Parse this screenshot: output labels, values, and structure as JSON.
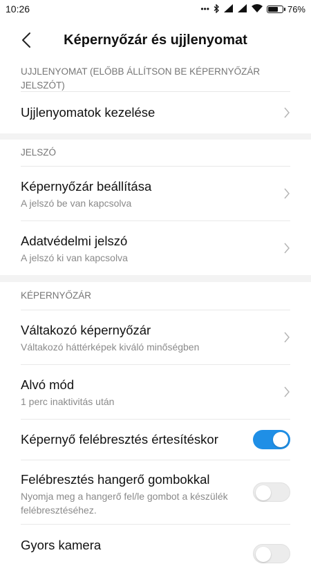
{
  "status_bar": {
    "time": "10:26",
    "battery_percent": "76%",
    "battery_level": 0.76,
    "icons": [
      "dots-icon",
      "bluetooth-icon",
      "signal-icon",
      "signal-icon",
      "wifi-icon",
      "battery-icon"
    ]
  },
  "header": {
    "title": "Képernyőzár és ujjlenyomat",
    "back_icon": "back-arrow-icon"
  },
  "sections": {
    "fingerprint": {
      "header": "UJJLENYOMAT (ELŐBB ÁLLÍTSON BE KÉPERNYŐZÁR JELSZÓT)",
      "manage_label": "Ujjlenyomatok kezelése"
    },
    "password": {
      "header": "JELSZÓ",
      "screen_lock_label": "Képernyőzár beállítása",
      "screen_lock_sub": "A jelszó be van kapcsolva",
      "privacy_label": "Adatvédelmi jelszó",
      "privacy_sub": "A jelszó ki van kapcsolva"
    },
    "screen_lock": {
      "header": "KÉPERNYŐZÁR",
      "rotating_label": "Váltakozó képernyőzár",
      "rotating_sub": "Váltakozó háttérképek kiváló minőségben",
      "sleep_label": "Alvó mód",
      "sleep_sub": "1 perc inaktivitás után",
      "wake_notif_label": "Képernyő felébresztés értesítéskor",
      "wake_notif_on": true,
      "wake_volume_label": "Felébresztés hangerő gombokkal",
      "wake_volume_sub": "Nyomja meg a hangerő fel/le gombot a készülék felébresztéséhez.",
      "wake_volume_on": false,
      "quick_camera_label": "Gyors kamera",
      "quick_camera_on": false
    }
  },
  "colors": {
    "accent": "#1f8fe6",
    "toggle_off": "#ececec",
    "section_gap": "#f3f3f3",
    "subtitle_gray": "#8a8a8a",
    "header_gray": "#757575"
  }
}
